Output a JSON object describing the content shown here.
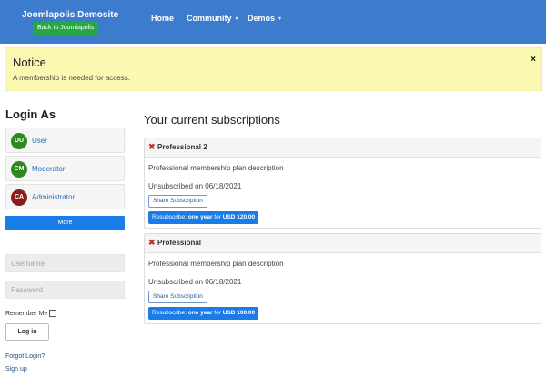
{
  "header": {
    "brand": "Joomlapolis Demosite",
    "back_label": "Back to Joomlapolis",
    "nav": [
      {
        "label": "Home"
      },
      {
        "label": "Community"
      },
      {
        "label": "Demos"
      }
    ],
    "color": "#3d7ccc"
  },
  "notice": {
    "title": "Notice",
    "message": "A membership is needed for access.",
    "close": "×"
  },
  "login_as": {
    "title": "Login As",
    "users": [
      {
        "initials": "DU",
        "name": "User",
        "color": "#2e8a1e"
      },
      {
        "initials": "CM",
        "name": "Moderator",
        "color": "#2e8a1e"
      },
      {
        "initials": "CA",
        "name": "Administrator",
        "color": "#8b1c1c"
      }
    ],
    "more_label": "More"
  },
  "login_form": {
    "username_placeholder": "Username",
    "password_placeholder": "Password",
    "remember_label": "Remember Me",
    "login_button": "Log in",
    "forgot_label": "Forgot Login?",
    "signup_label": "Sign up"
  },
  "subscriptions": {
    "title": "Your current subscriptions",
    "items": [
      {
        "name": "Professional 2",
        "description": "Professional membership plan description",
        "status": "Unsubscribed on 06/18/2021",
        "share_label": "Share Subscription",
        "resub_prefix": "Resubscribe: ",
        "resub_period": "one year",
        "resub_mid": " for ",
        "resub_price": "USD 120.00"
      },
      {
        "name": "Professional",
        "description": "Professional membership plan description",
        "status": "Unsubscribed on 06/18/2021",
        "share_label": "Share Subscription",
        "resub_prefix": "Resubscribe: ",
        "resub_period": "one year",
        "resub_mid": " for ",
        "resub_price": "USD 100.00"
      }
    ]
  }
}
